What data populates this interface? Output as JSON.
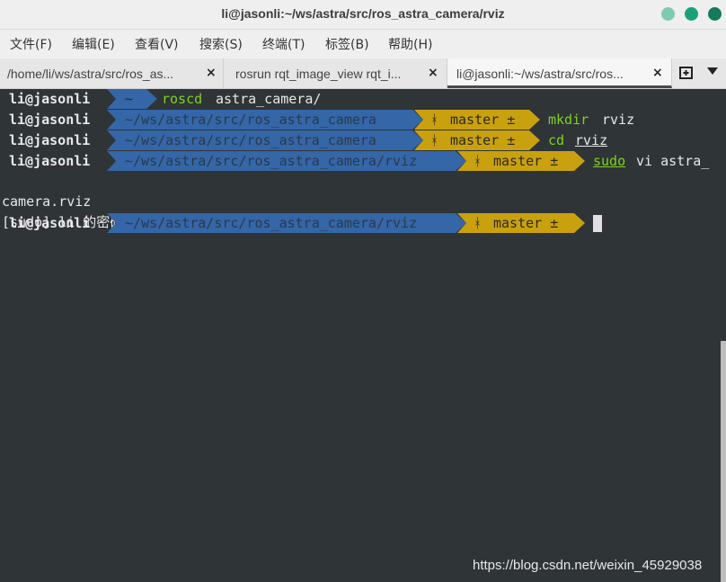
{
  "window": {
    "title": "li@jasonli:~/ws/astra/src/ros_astra_camera/rviz",
    "buttons": [
      {
        "name": "minimize",
        "color": "#7fcbb0"
      },
      {
        "name": "maximize",
        "color": "#1aa17a"
      },
      {
        "name": "close",
        "color": "#157a5b"
      }
    ]
  },
  "menu": {
    "items": [
      "文件(F)",
      "编辑(E)",
      "查看(V)",
      "搜索(S)",
      "终端(T)",
      "标签(B)",
      "帮助(H)"
    ]
  },
  "tabs": [
    {
      "label": "/home/li/ws/astra/src/ros_astra_camera",
      "display": "/home/li/ws/astra/src/ros_as...",
      "active": false
    },
    {
      "label": "rosrun rqt_image_view rqt_image_view",
      "display": "rosrun rqt_image_view rqt_i...",
      "active": false
    },
    {
      "label": "li@jasonli:~/ws/astra/src/ros_astra_camera/rviz",
      "display": "li@jasonli:~/ws/astra/src/ros...",
      "active": true
    }
  ],
  "tab_close_glyph": "×",
  "colors": {
    "terminal_bg": "#2f3437",
    "path_segment": "#3466a8",
    "git_segment": "#c9a10f",
    "command_green": "#7dd321"
  },
  "terminal": {
    "lines": [
      {
        "user": "li@jasonli",
        "path": "~",
        "git": null,
        "command": "roscd",
        "args": "astra_camera/"
      },
      {
        "user": "li@jasonli",
        "path": "~/ws/astra/src/ros_astra_camera",
        "git": "master ±",
        "command": "mkdir",
        "args": "rviz"
      },
      {
        "user": "li@jasonli",
        "path": "~/ws/astra/src/ros_astra_camera",
        "git": "master ±",
        "command": "cd",
        "args": "rviz"
      },
      {
        "user": "li@jasonli",
        "path": "~/ws/astra/src/ros_astra_camera/rviz",
        "git": "master ±",
        "command": "sudo",
        "args": "vi astra_"
      },
      {
        "plain": "camera.rviz"
      },
      {
        "plain": "[sudo] li 的密码："
      },
      {
        "user": "li@jasonli",
        "path": "~/ws/astra/src/ros_astra_camera/rviz",
        "git": "master ±",
        "command": "",
        "args": ""
      }
    ]
  },
  "watermark": "https://blog.csdn.net/weixin_45929038"
}
